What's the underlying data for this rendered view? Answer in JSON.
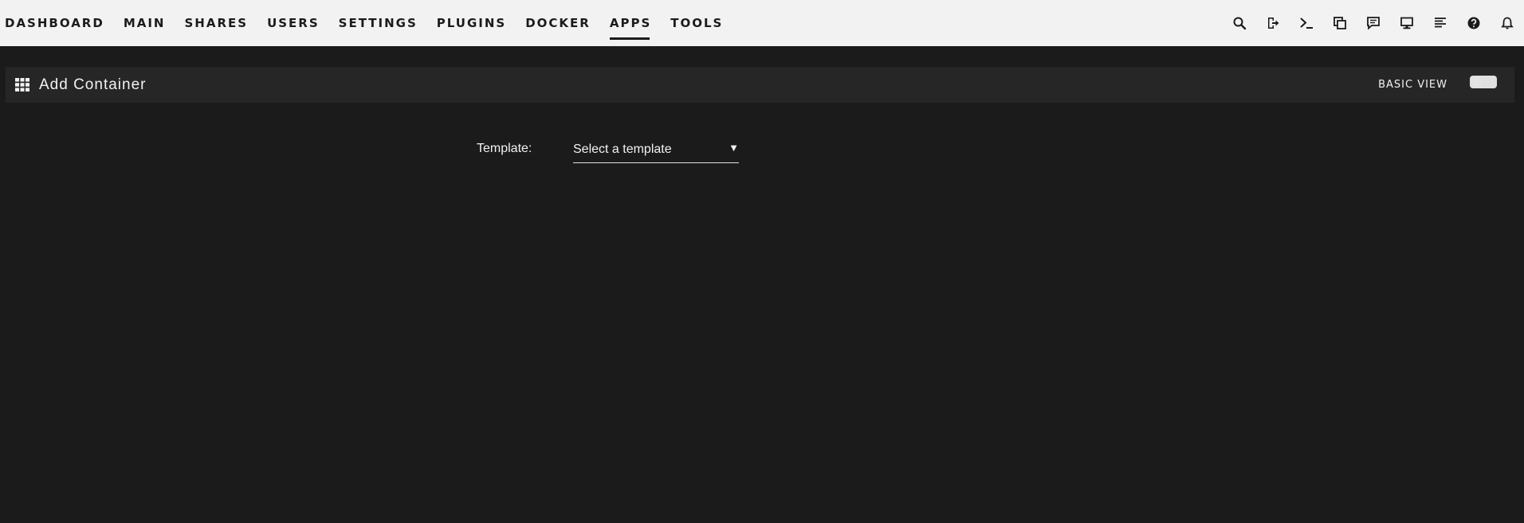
{
  "nav": {
    "items": [
      {
        "label": "DASHBOARD"
      },
      {
        "label": "MAIN"
      },
      {
        "label": "SHARES"
      },
      {
        "label": "USERS"
      },
      {
        "label": "SETTINGS"
      },
      {
        "label": "PLUGINS"
      },
      {
        "label": "DOCKER"
      },
      {
        "label": "APPS"
      },
      {
        "label": "TOOLS"
      }
    ],
    "active": "APPS"
  },
  "toolbar_icons": [
    "search-icon",
    "logout-icon",
    "terminal-icon",
    "copy-icon",
    "feedback-icon",
    "monitor-icon",
    "log-icon",
    "help-icon",
    "bell-icon"
  ],
  "panel": {
    "title": "Add Container",
    "basic_view_label": "BASIC VIEW",
    "basic_view_on": false
  },
  "form": {
    "template_label": "Template:",
    "template_select_value": "Select a template",
    "caret": "▼"
  },
  "colors": {
    "background": "#1c1b1c",
    "topbar": "#f2f2f2",
    "panel": "#262626",
    "text_light": "#f2f2f2",
    "text_dark": "#1c1b1c"
  }
}
